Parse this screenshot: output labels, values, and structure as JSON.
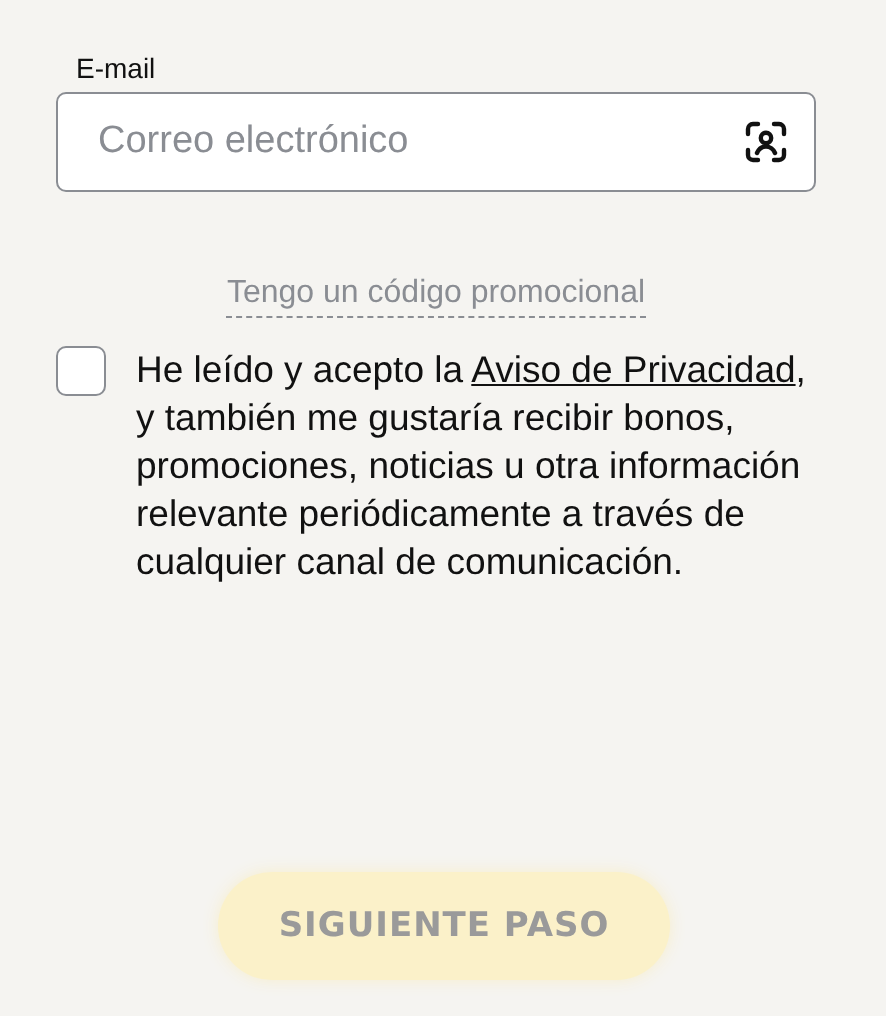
{
  "email": {
    "label": "E-mail",
    "placeholder": "Correo electrónico"
  },
  "promo_link": "Tengo un código promocional",
  "consent": {
    "checked": false,
    "before": "He leído y acepto la",
    "link": "Aviso de Privacidad",
    "after": ", y también me gustaría recibir bonos, promociones, noticias u otra información relevante periódicamente a través de cualquier canal de comunicación."
  },
  "next_button": {
    "label": "SIGUIENTE PASO",
    "disabled": true
  }
}
